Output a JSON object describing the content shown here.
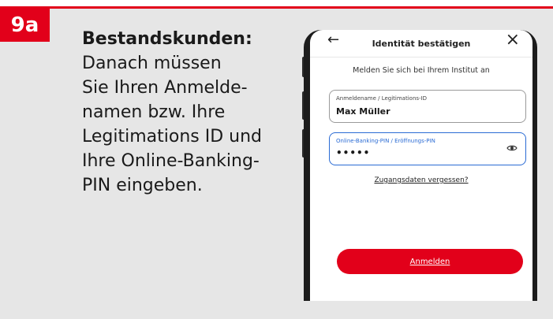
{
  "step": {
    "badge": "9a"
  },
  "instruction": {
    "title": "Bestandskunden:",
    "lines": [
      "Danach müssen",
      "Sie Ihren Anmelde-",
      "namen bzw. Ihre",
      "Legitimations ID und",
      "Ihre Online-Banking-",
      "PIN eingeben."
    ]
  },
  "app": {
    "header_title": "Identität bestätigen",
    "subtitle": "Melden Sie sich bei Ihrem Institut an",
    "username_field": {
      "label": "Anmeldename / Legitimations-ID",
      "value": "Max Müller"
    },
    "pin_field": {
      "label": "Online-Banking-PIN / Eröffnungs-PIN",
      "value": "•••••"
    },
    "forgot_link": "Zugangsdaten vergessen?",
    "login_button": "Anmelden"
  },
  "colors": {
    "brand_red": "#e2001a",
    "focus_blue": "#2a6bd4",
    "panel_gray": "#e6e6e6"
  },
  "icons": {
    "back": "arrow-left-icon",
    "close": "close-icon",
    "toggle_visibility": "eye-icon"
  }
}
